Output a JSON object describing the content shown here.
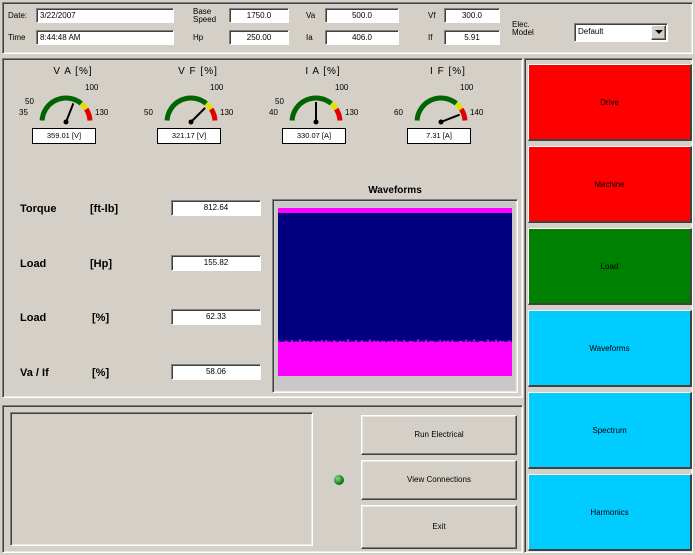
{
  "header": {
    "date_label": "Date:",
    "date_value": "3/22/2007",
    "time_label": "Time",
    "time_value": "8:44:48 AM",
    "base_speed_label_1": "Base",
    "base_speed_label_2": "Speed",
    "base_speed_value": "1750.0",
    "hp_label": "Hp",
    "hp_value": "250.00",
    "va_label": "Va",
    "va_value": "500.0",
    "ia_label": "Ia",
    "ia_value": "406.0",
    "vf_label": "Vf",
    "vf_value": "300.0",
    "if_label": "If",
    "if_value": "5.91",
    "elec_model_label_1": "Elec.",
    "elec_model_label_2": "Model",
    "elec_model_selected": "Default"
  },
  "gauges": [
    {
      "title": "V A [%]",
      "max": "100",
      "mid": "50",
      "low": "35",
      "high": "130",
      "reading": "359.01 [V]",
      "needle_pct": 0.62
    },
    {
      "title": "V F [%]",
      "max": "100",
      "mid": "",
      "low": "50",
      "high": "130",
      "reading": "321.17 [V]",
      "needle_pct": 0.75
    },
    {
      "title": "I A [%]",
      "max": "100",
      "mid": "50",
      "low": "40",
      "high": "130",
      "reading": "330.07 [A]",
      "needle_pct": 0.5
    },
    {
      "title": "I F [%]",
      "max": "100",
      "mid": "",
      "low": "60",
      "high": "140",
      "reading": "7.31 [A]",
      "needle_pct": 0.88
    }
  ],
  "measurements": [
    {
      "name": "Torque",
      "unit": "[ft-lb]",
      "value": "812.64"
    },
    {
      "name": "Load",
      "unit": "[Hp]",
      "value": "155.82"
    },
    {
      "name": "Load",
      "unit": "[%]",
      "value": "62.33"
    },
    {
      "name": "Va / If",
      "unit": "[%]",
      "value": "58.06"
    }
  ],
  "waveforms": {
    "title": "Waveforms"
  },
  "buttons": {
    "run_electrical": "Run Electrical",
    "view_connections": "View Connections",
    "exit": "Exit"
  },
  "side": {
    "drive": "Drive",
    "machine": "Machine",
    "load": "Load",
    "waveforms": "Waveforms",
    "spectrum": "Spectrum",
    "harmonics": "Harmonics"
  },
  "colors": {
    "red": "#ff0000",
    "green": "#008000",
    "cyan": "#00ccff",
    "wave_blue": "#000080",
    "wave_magenta": "#ff00ff",
    "status_led": "#1a7a1a"
  }
}
